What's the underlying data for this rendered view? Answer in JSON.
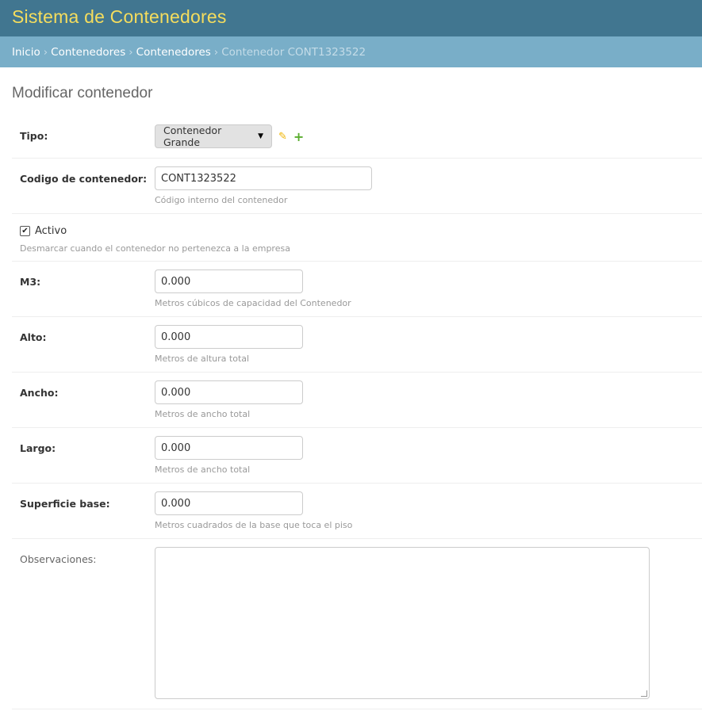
{
  "header": {
    "site_title": "Sistema de Contenedores"
  },
  "breadcrumbs": {
    "items": [
      "Inicio",
      "Contenedores",
      "Contenedores"
    ],
    "current": "Contenedor CONT1323522",
    "separator": "›"
  },
  "page": {
    "title": "Modificar contenedor"
  },
  "form": {
    "tipo": {
      "label": "Tipo:",
      "selected": "Contenedor Grande"
    },
    "codigo": {
      "label": "Codigo de contenedor:",
      "value": "CONT1323522",
      "help": "Código interno del contenedor"
    },
    "activo": {
      "label": "Activo",
      "checked": true,
      "check_glyph": "✔",
      "help": "Desmarcar cuando el contenedor no pertenezca a la empresa"
    },
    "m3": {
      "label": "M3:",
      "value": "0.000",
      "help": "Metros cúbicos de capacidad del Contenedor"
    },
    "alto": {
      "label": "Alto:",
      "value": "0.000",
      "help": "Metros de altura total"
    },
    "ancho": {
      "label": "Ancho:",
      "value": "0.000",
      "help": "Metros de ancho total"
    },
    "largo": {
      "label": "Largo:",
      "value": "0.000",
      "help": "Metros de ancho total"
    },
    "superficie": {
      "label": "Superficie base:",
      "value": "0.000",
      "help": "Metros cuadrados de la base que toca el piso"
    },
    "observaciones": {
      "label": "Observaciones:",
      "value": ""
    }
  },
  "icons": {
    "edit": "pencil-icon",
    "add": "plus-icon",
    "dropdown": "caret-down-icon"
  },
  "colors": {
    "header_bg": "#417690",
    "site_title": "#f5dd5d",
    "breadcrumbs_bg": "#79aec8",
    "pencil": "#f0b400",
    "plus": "#5aad2e"
  }
}
